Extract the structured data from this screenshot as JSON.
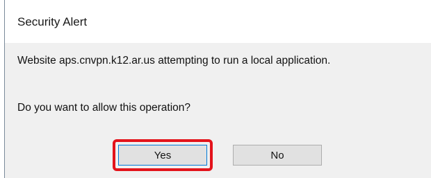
{
  "dialog": {
    "title": "Security Alert",
    "message": "Website aps.cnvpn.k12.ar.us attempting to run a local application.",
    "question": "Do you want to allow this operation?",
    "yes_label": "Yes",
    "no_label": "No",
    "highlight_color": "#e3131b"
  }
}
